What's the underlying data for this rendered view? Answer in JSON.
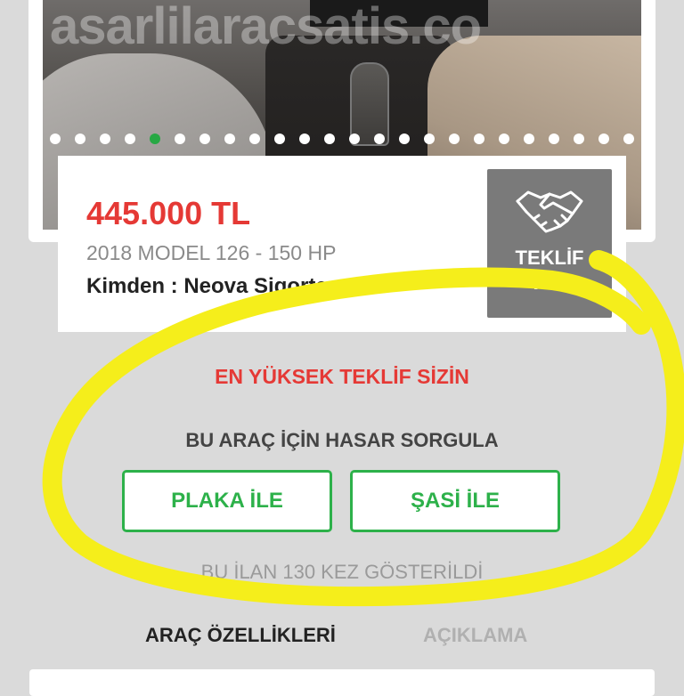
{
  "gallery": {
    "watermark": "asarlilaracsatis.co",
    "image_count": 24,
    "active_index": 4,
    "accent_color": "#27a844"
  },
  "listing": {
    "price": "445.000 TL",
    "model_info": "2018 MODEL 126 - 150 HP",
    "seller": "Kimden : Neova Sigorta",
    "offer_button": {
      "label": "TEKLİF VER",
      "icon": "handshake-icon"
    }
  },
  "bid_status": "EN YÜKSEK TEKLİF SİZİN",
  "damage_check": {
    "title": "BU ARAÇ İÇİN HASAR SORGULA",
    "plate_button": "PLAKA İLE",
    "chassis_button": "ŞASİ İLE"
  },
  "view_count_text": "BU İLAN 130 KEZ GÖSTERİLDİ",
  "tabs": [
    {
      "label": "ARAÇ ÖZELLİKLERİ",
      "active": true
    },
    {
      "label": "AÇIKLAMA",
      "active": false
    }
  ],
  "colors": {
    "price": "#e53935",
    "primary_green": "#2db14a",
    "offer_button_bg": "#7a7a7a",
    "highlight": "#f5ee1b"
  }
}
